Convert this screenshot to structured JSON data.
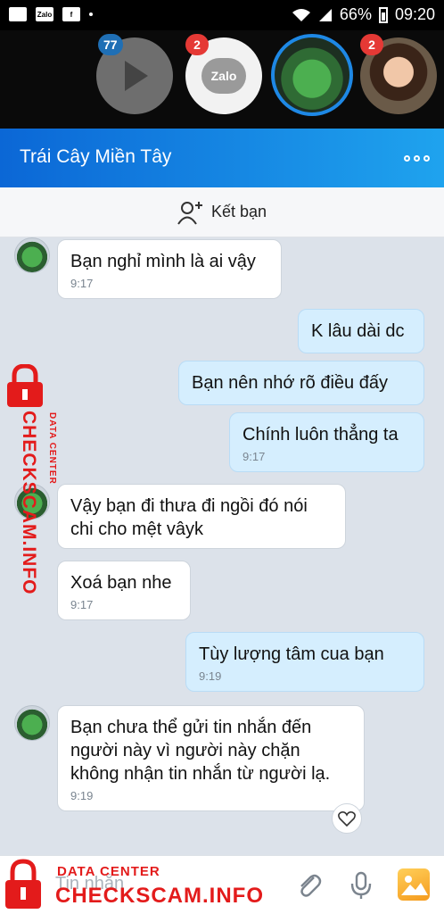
{
  "status_bar": {
    "left_icons": [
      "zalo-app-icon",
      "zalo-app-icon",
      "facebook-icon"
    ],
    "left_labels": [
      "",
      "Zalo",
      "f"
    ],
    "battery": "66%",
    "time": "09:20"
  },
  "chat_heads": {
    "video_badge": "77",
    "zalo_label": "Zalo",
    "zalo_badge": "2",
    "person_badge": "2"
  },
  "header": {
    "title": "Trái Cây Miền Tây"
  },
  "add_friend": {
    "label": "Kết bạn"
  },
  "messages": [
    {
      "direction": "in",
      "text": "Bạn nghỉ mình là ai vậy",
      "time": "9:17"
    },
    {
      "direction": "out",
      "text": "K lâu dài dc",
      "time": ""
    },
    {
      "direction": "out",
      "text": "Bạn nên  nhớ rõ điều đấy",
      "time": ""
    },
    {
      "direction": "out",
      "text": "Chính luôn thẳng ta",
      "time": "9:17"
    },
    {
      "direction": "in",
      "text": "Vậy bạn đi thưa đi ngồi đó nói chi cho mệt vâyk",
      "time": ""
    },
    {
      "direction": "in",
      "text": "Xoá bạn nhe",
      "time": "9:17"
    },
    {
      "direction": "out",
      "text": "Tùy  lượng  tâm cua bạn",
      "time": "9:19"
    },
    {
      "direction": "in",
      "text": "Bạn chưa thể gửi tin nhắn đến người này vì người này chặn không nhận tin nhắn từ người lạ.",
      "time": "9:19"
    }
  ],
  "input": {
    "placeholder": "Tin nhắn"
  },
  "watermark": {
    "small": "DATA CENTER",
    "big": "CHECKSCAM.INFO"
  },
  "colors": {
    "header_start": "#0b67d6",
    "header_end": "#1fa3ee",
    "outgoing_bubble": "#d5eefe",
    "badge_red": "#e53935",
    "watermark_red": "#e31b1b"
  }
}
